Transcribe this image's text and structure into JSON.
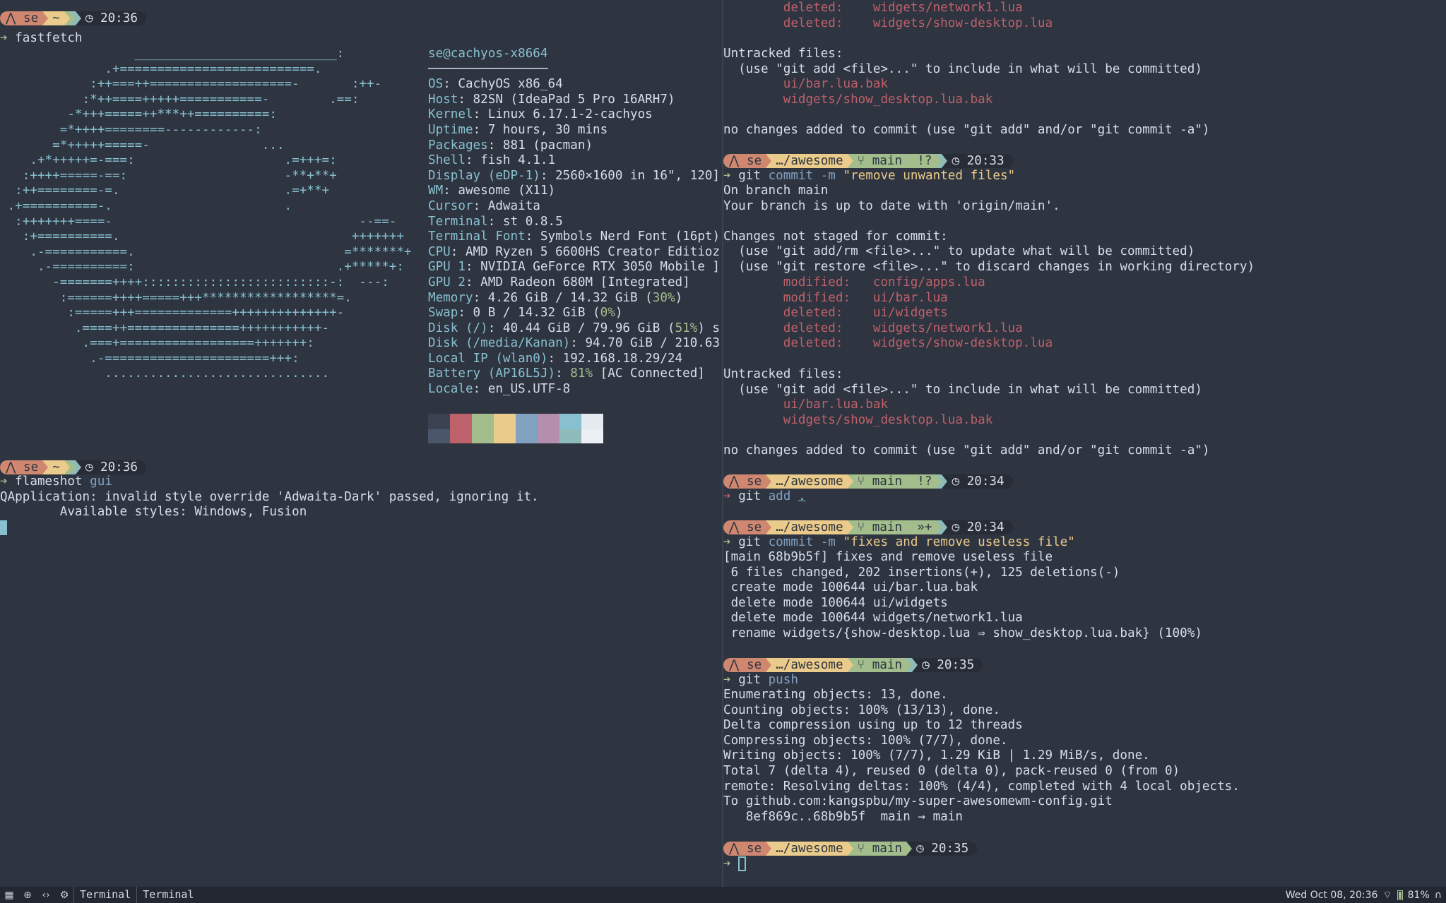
{
  "prompt": {
    "user": "se",
    "home": "~",
    "repo_dir": "…/awesome",
    "branch": "main"
  },
  "left": {
    "prompt1_time": "20:36",
    "cmd1": "fastfetch",
    "logo_lines": [
      "                  ___________________________:",
      "              .+==========================.",
      "            :++===++===================-       :++-",
      "           :*++====+++++===========-        .==:",
      "         -*+++=====++***++==========:",
      "        =*++++========------------:",
      "       =*+++++=====-               ...",
      "    .+*+++++=-===:                    .=+++=:",
      "   :++++=====-==:                     -**+**+",
      "  :++========-=.                      .=+**+",
      " .+==========-.                       .",
      "  :+++++++====-                                 --==-",
      "   :+==========.                               +++++++",
      "    .-===========.                            =*******+",
      "     .-==========:                           .+*****+:",
      "       -=======++++:::::::::::::::::::::::::-:  ---:",
      "        :======++++=====+++******************=.",
      "         :=====+++=============++++++++++++++-",
      "          .====++===============+++++++++++-",
      "           .===+==================+++++++:",
      "            .-======================+++:",
      "              .............................."
    ],
    "info_title": "se@cachyos-x8664",
    "info_rule": "────────────────",
    "info": [
      {
        "k": "OS",
        "v": ": CachyOS x86_64"
      },
      {
        "k": "Host",
        "v": ": 82SN (IdeaPad 5 Pro 16ARH7)"
      },
      {
        "k": "Kernel",
        "v": ": Linux 6.17.1-2-cachyos"
      },
      {
        "k": "Uptime",
        "v": ": 7 hours, 30 mins"
      },
      {
        "k": "Packages",
        "v": ": 881 (pacman)"
      },
      {
        "k": "Shell",
        "v": ": fish 4.1.1"
      },
      {
        "k": "Display (eDP-1)",
        "v": ": 2560×1600 in 16\", 120]"
      },
      {
        "k": "WM",
        "v": ": awesome (X11)"
      },
      {
        "k": "Cursor",
        "v": ": Adwaita"
      },
      {
        "k": "Terminal",
        "v": ": st 0.8.5"
      },
      {
        "k": "Terminal Font",
        "v": ": Symbols Nerd Font (16pt)"
      },
      {
        "k": "CPU",
        "v": ": AMD Ryzen 5 6600HS Creator Editioz"
      },
      {
        "k": "GPU 1",
        "v": ": NVIDIA GeForce RTX 3050 Mobile ]"
      },
      {
        "k": "GPU 2",
        "v": ": AMD Radeon 680M [Integrated]"
      },
      {
        "k": "Memory",
        "v": ": 4.26 GiB / 14.32 GiB (",
        "p": "30%",
        "t": ")"
      },
      {
        "k": "Swap",
        "v": ": 0 B / 14.32 GiB (",
        "p": "0%",
        "t": ")"
      },
      {
        "k": "Disk (/)",
        "v": ": 40.44 GiB / 79.96 GiB (",
        "p": "51%",
        "t": ") s"
      },
      {
        "k": "Disk (/media/Kanan)",
        "v": ": 94.70 GiB / 210.63"
      },
      {
        "k": "Local IP (wlan0)",
        "v": ": 192.168.18.29/24"
      },
      {
        "k": "Battery (AP16L5J)",
        "v": ": ",
        "p": "81%",
        "t": " [AC Connected]"
      },
      {
        "k": "Locale",
        "v": ": en_US.UTF-8"
      }
    ],
    "palette_top": [
      "#3b4252",
      "#bf616a",
      "#a3be8c",
      "#ebcb8b",
      "#81a1c1",
      "#b48ead",
      "#88c0d0",
      "#e5e9f0"
    ],
    "palette_bottom": [
      "#4c566a",
      "#bf616a",
      "#a3be8c",
      "#ebcb8b",
      "#81a1c1",
      "#b48ead",
      "#8fbcbb",
      "#eceff4"
    ],
    "prompt2_time": "20:36",
    "cmd2_name": "flameshot",
    "cmd2_arg": "gui",
    "out2": [
      "QApplication: invalid style override 'Adwaita-Dark' passed, ignoring it.",
      "        Available styles: Windows, Fusion"
    ]
  },
  "right": {
    "top_deleted": [
      "        deleted:    widgets/network1.lua",
      "        deleted:    widgets/show-desktop.lua"
    ],
    "untracked_header": "Untracked files:",
    "untracked_hint": "  (use \"git add <file>...\" to include in what will be committed)",
    "untracked_files": [
      "        ui/bar.lua.bak",
      "        widgets/show_desktop.lua.bak"
    ],
    "no_changes": "no changes added to commit (use \"git add\" and/or \"git commit -a\")",
    "p1": {
      "status": "!?",
      "time": "20:33"
    },
    "c1": {
      "name": "git",
      "rest": "commit -m",
      "msg": "\"remove unwanted files\""
    },
    "c1_out": [
      "On branch main",
      "Your branch is up to date with 'origin/main'.",
      "",
      "Changes not staged for commit:",
      "  (use \"git add/rm <file>...\" to update what will be committed)",
      "  (use \"git restore <file>...\" to discard changes in working directory)"
    ],
    "c1_changes": [
      "        modified:   config/apps.lua",
      "        modified:   ui/bar.lua",
      "        deleted:    ui/widgets",
      "        deleted:    widgets/network1.lua",
      "        deleted:    widgets/show-desktop.lua"
    ],
    "p2": {
      "status": "!?",
      "time": "20:34"
    },
    "c2": {
      "name": "git",
      "rest": "add",
      "arg": "."
    },
    "p3": {
      "status": "»+",
      "time": "20:34"
    },
    "c3": {
      "name": "git",
      "rest": "commit -m",
      "msg": "\"fixes and remove useless file\""
    },
    "c3_out": [
      "[main 68b9b5f] fixes and remove useless file",
      " 6 files changed, 202 insertions(+), 125 deletions(-)",
      " create mode 100644 ui/bar.lua.bak",
      " delete mode 100644 ui/widgets",
      " delete mode 100644 widgets/network1.lua",
      " rename widgets/{show-desktop.lua ⇒ show_desktop.lua.bak} (100%)"
    ],
    "p4": {
      "time": "20:35"
    },
    "c4": {
      "name": "git",
      "rest": "push"
    },
    "c4_out": [
      "Enumerating objects: 13, done.",
      "Counting objects: 100% (13/13), done.",
      "Delta compression using up to 12 threads",
      "Compressing objects: 100% (7/7), done.",
      "Writing objects: 100% (7/7), 1.29 KiB | 1.29 MiB/s, done.",
      "Total 7 (delta 4), reused 0 (delta 0), pack-reused 0 (from 0)",
      "remote: Resolving deltas: 100% (4/4), completed with 4 local objects.",
      "To github.com:kangspbu/my-super-awesomewm-config.git",
      "   8ef869c..68b9b5f  main → main"
    ],
    "p5": {
      "time": "20:35"
    }
  },
  "taskbar": {
    "tasks": [
      "Terminal",
      "Terminal"
    ],
    "clock": "Wed Oct 08, 20:36",
    "battery": "81%",
    "battery_level": 0.81,
    "icons": [
      "apps-grid-icon",
      "globe-icon",
      "code-icon",
      "settings-icon"
    ]
  }
}
